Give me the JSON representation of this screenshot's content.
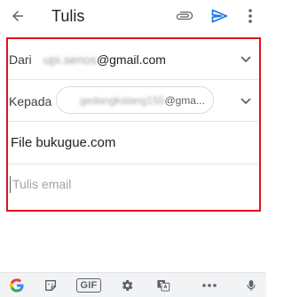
{
  "app_bar": {
    "title": "Tulis",
    "icons": [
      "back-arrow-icon",
      "paperclip-icon",
      "send-icon",
      "more-vert-icon"
    ],
    "send_color": "#1a73e8"
  },
  "compose": {
    "from_label": "Dari",
    "from_hidden": "upi.senos",
    "from_domain": "@gmail.com",
    "to_label": "Kepada",
    "to_hidden": "gedangkalang155",
    "to_visible": "@gma...",
    "subject": "File bukugue.com",
    "body_placeholder": "Tulis email"
  },
  "highlight_color": "#e0141e",
  "keyboard_toolbar": {
    "gif_label": "GIF",
    "icons": [
      "google-g-icon",
      "sticker-icon",
      "gif-icon",
      "gear-icon",
      "translate-icon",
      "more-horiz-icon",
      "microphone-icon"
    ]
  }
}
